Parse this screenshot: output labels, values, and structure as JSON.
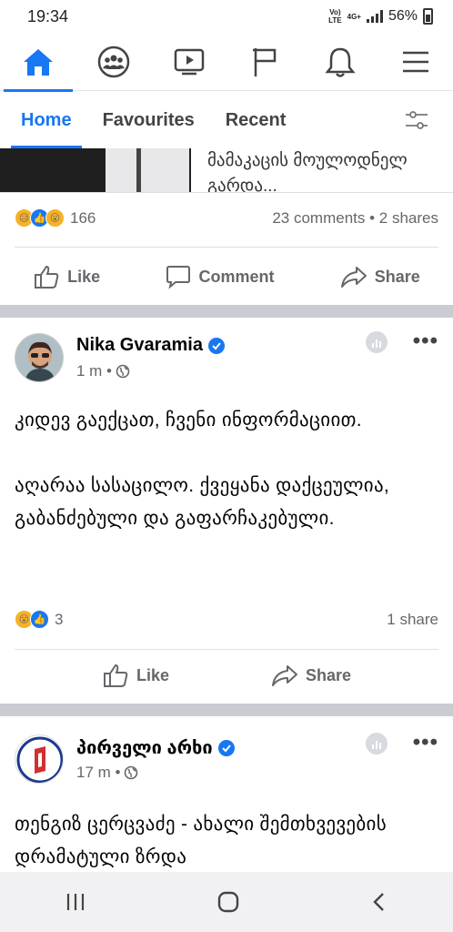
{
  "status": {
    "time": "19:34",
    "network_top": "Vo)",
    "network_bottom": "LTE",
    "net_4g": "4G+",
    "battery": "56%"
  },
  "nav": {
    "items": [
      "home-icon",
      "groups-icon",
      "watch-icon",
      "pages-icon",
      "notifications-icon",
      "menu-icon"
    ],
    "accent": "#1877f2"
  },
  "tabs": [
    {
      "label": "Home"
    },
    {
      "label": "Favourites"
    },
    {
      "label": "Recent"
    }
  ],
  "post1": {
    "link_title": "მამაკაცის მოულოდნელ გარდა...",
    "reactions_count": "166",
    "comments_shares": "23 comments • 2 shares"
  },
  "actions": {
    "like": "Like",
    "comment": "Comment",
    "share": "Share"
  },
  "post2": {
    "author": "Nika Gvaramia",
    "time": "1 m •",
    "paragraph1": "კიდევ გაექცათ, ჩვენი ინფორმაციით.",
    "paragraph2": "აღარაა სასაცილო. ქვეყანა დაქცეულია, გაბანძებული და გაფარჩაკებული.",
    "reactions_count": "3",
    "shares": "1 share"
  },
  "post3": {
    "author": "პირველი არხი",
    "time": "17 m •",
    "text": "თენგიზ ცერცვაძე - ახალი შემთხვევების დრამატული ზრდა"
  }
}
